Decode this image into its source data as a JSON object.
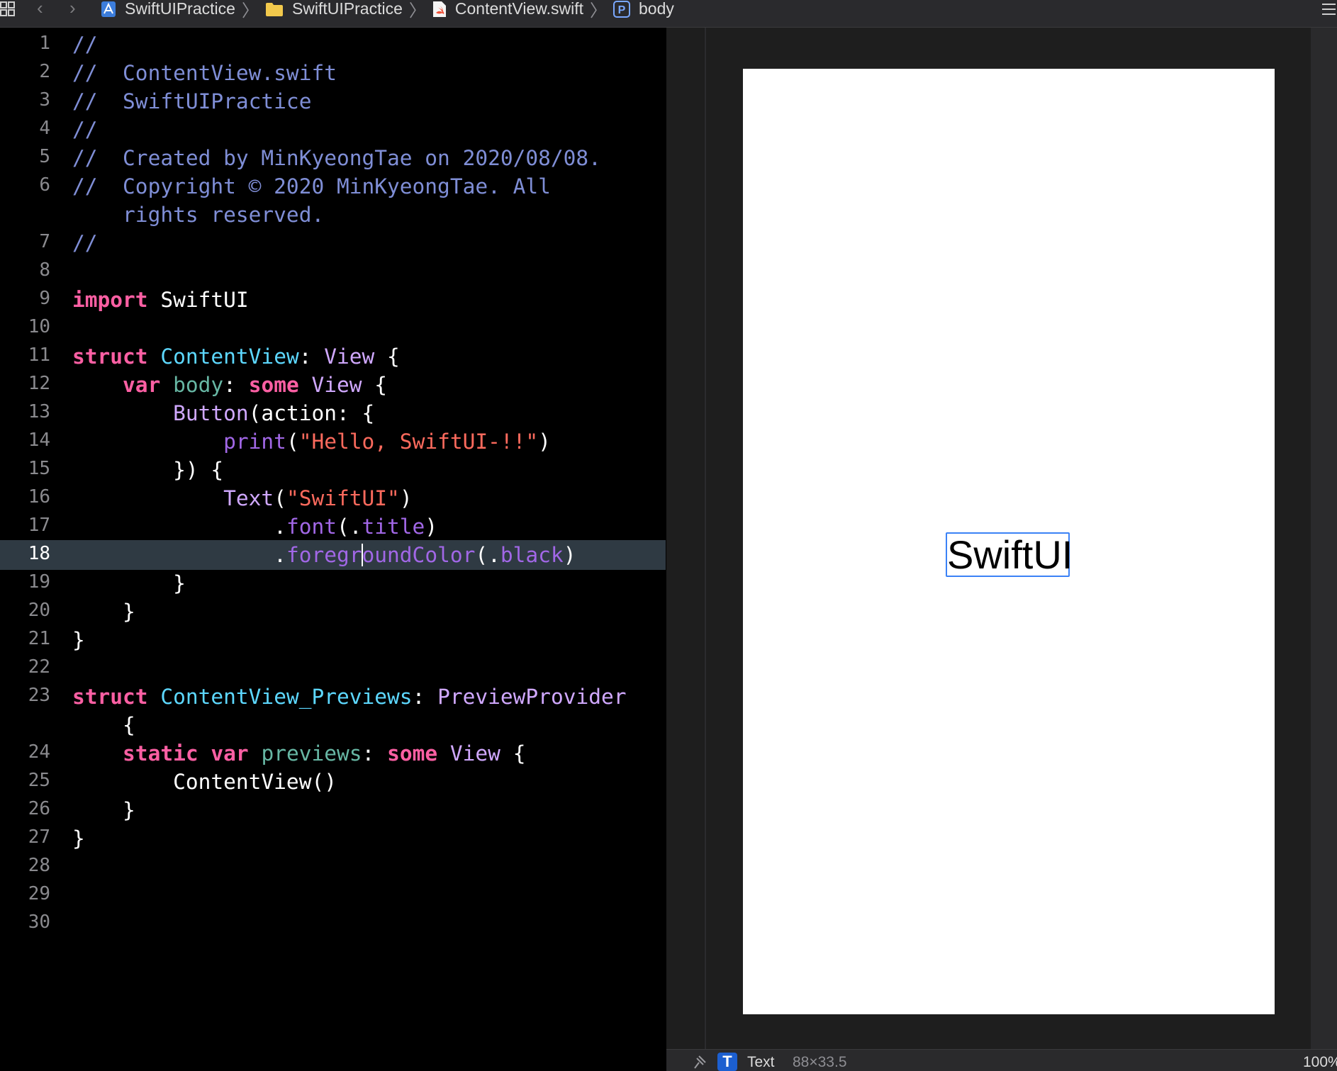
{
  "jump_bar": {
    "crumbs": [
      {
        "label": "SwiftUIPractice",
        "icon": "project-icon"
      },
      {
        "label": "SwiftUIPractice",
        "icon": "folder-icon"
      },
      {
        "label": "ContentView.swift",
        "icon": "swift-file-icon"
      },
      {
        "label": "body",
        "icon": "property-icon"
      }
    ]
  },
  "editor": {
    "current_line": 18,
    "lines": [
      {
        "num": "1",
        "code": "//"
      },
      {
        "num": "2",
        "code": "//  ContentView.swift"
      },
      {
        "num": "3",
        "code": "//  SwiftUIPractice"
      },
      {
        "num": "4",
        "code": "//"
      },
      {
        "num": "5",
        "code": "//  Created by MinKyeongTae on 2020/08/08."
      },
      {
        "num": "6",
        "code": "//  Copyright © 2020 MinKyeongTae. All"
      },
      {
        "num": "",
        "code": "    rights reserved."
      },
      {
        "num": "7",
        "code": "//"
      },
      {
        "num": "8",
        "code": ""
      },
      {
        "num": "9",
        "code": "import SwiftUI"
      },
      {
        "num": "10",
        "code": ""
      },
      {
        "num": "11",
        "code": "struct ContentView: View {"
      },
      {
        "num": "12",
        "code": "    var body: some View {"
      },
      {
        "num": "13",
        "code": "        Button(action: {"
      },
      {
        "num": "14",
        "code": "            print(\"Hello, SwiftUI-!!\")"
      },
      {
        "num": "15",
        "code": "        }) {"
      },
      {
        "num": "16",
        "code": "            Text(\"SwiftUI\")"
      },
      {
        "num": "17",
        "code": "                .font(.title)"
      },
      {
        "num": "18",
        "code": "                .foregroundColor(.black)"
      },
      {
        "num": "19",
        "code": "        }"
      },
      {
        "num": "20",
        "code": "    }"
      },
      {
        "num": "21",
        "code": "}"
      },
      {
        "num": "22",
        "code": ""
      },
      {
        "num": "23",
        "code": "struct ContentView_Previews: PreviewProvider"
      },
      {
        "num": "",
        "code": "    {"
      },
      {
        "num": "24",
        "code": "    static var previews: some View {"
      },
      {
        "num": "25",
        "code": "        ContentView()"
      },
      {
        "num": "26",
        "code": "    }"
      },
      {
        "num": "27",
        "code": "}"
      },
      {
        "num": "28",
        "code": ""
      },
      {
        "num": "29",
        "code": ""
      },
      {
        "num": "30",
        "code": ""
      }
    ]
  },
  "preview": {
    "text": "SwiftUI",
    "selection_color": "#3b82f6"
  },
  "status_bar": {
    "element_badge": "T",
    "element_kind": "Text",
    "element_size": "88×33.5",
    "zoom": "100%"
  },
  "colors": {
    "comment": "#7f8ed6",
    "keyword": "#fc5fa3",
    "type": "#d0a8ff",
    "type_declaration": "#5dd8ff",
    "string": "#fc6a5d",
    "current_line": "#2f3a43"
  }
}
